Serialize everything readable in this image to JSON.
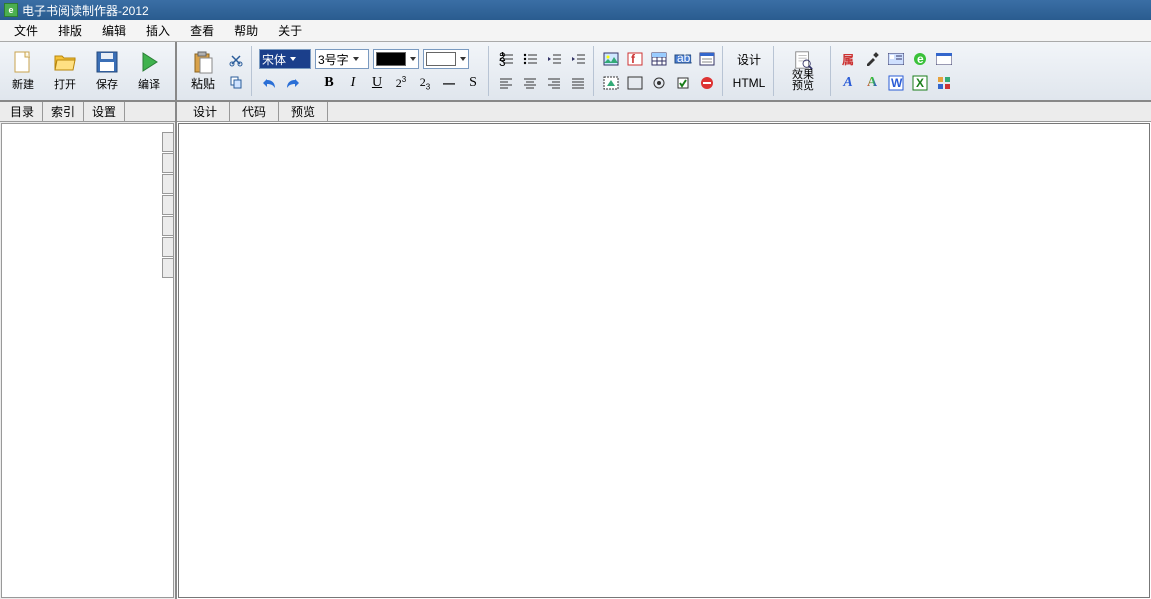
{
  "window": {
    "title": "电子书阅读制作器-2012"
  },
  "menu": {
    "items": [
      "文件",
      "排版",
      "编辑",
      "插入",
      "查看",
      "帮助",
      "关于"
    ]
  },
  "main_toolbar": {
    "left": [
      {
        "name": "new-button",
        "label": "新建",
        "icon": "file-new"
      },
      {
        "name": "open-button",
        "label": "打开",
        "icon": "folder-open"
      },
      {
        "name": "save-button",
        "label": "保存",
        "icon": "diskette"
      },
      {
        "name": "compile-button",
        "label": "编译",
        "icon": "play-green"
      }
    ],
    "paste": {
      "label": "粘贴"
    },
    "font_family": "宋体",
    "font_size": "3号字",
    "forecolor": "#000000",
    "backcolor": "#ffffff",
    "design_label": "设计",
    "html_label": "HTML",
    "preview_label": "效果预览",
    "attr_label": "属"
  },
  "left_panel": {
    "tabs": [
      "目录",
      "索引",
      "设置"
    ]
  },
  "right_panel": {
    "tabs": [
      "设计",
      "代码",
      "预览"
    ]
  }
}
